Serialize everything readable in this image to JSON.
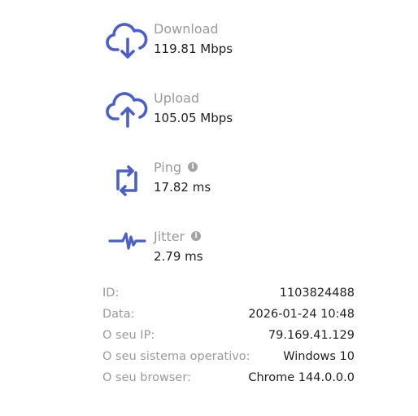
{
  "colors": {
    "accent": "#4b5fc8",
    "label": "#9a9a9a",
    "value": "#1e1e1e"
  },
  "metrics": [
    {
      "icon": "cloud-download-icon",
      "label": "Download",
      "value": "119.81 Mbps"
    },
    {
      "icon": "cloud-upload-icon",
      "label": "Upload",
      "value": "105.05 Mbps"
    },
    {
      "icon": "refresh-arrows-icon",
      "label": "Ping",
      "value": "17.82 ms",
      "info_icon": "info-icon"
    },
    {
      "icon": "pulse-wave-icon",
      "label": "Jitter",
      "value": "2.79 ms",
      "info_icon": "info-icon"
    }
  ],
  "details": [
    {
      "key": "ID:",
      "value": "1103824488"
    },
    {
      "key": "Data:",
      "value": "2026-01-24 10:48"
    },
    {
      "key": "O seu IP:",
      "value": "79.169.41.129"
    },
    {
      "key": "O seu sistema operativo:",
      "value": "Windows 10"
    },
    {
      "key": "O seu browser:",
      "value": "Chrome 144.0.0.0"
    }
  ]
}
